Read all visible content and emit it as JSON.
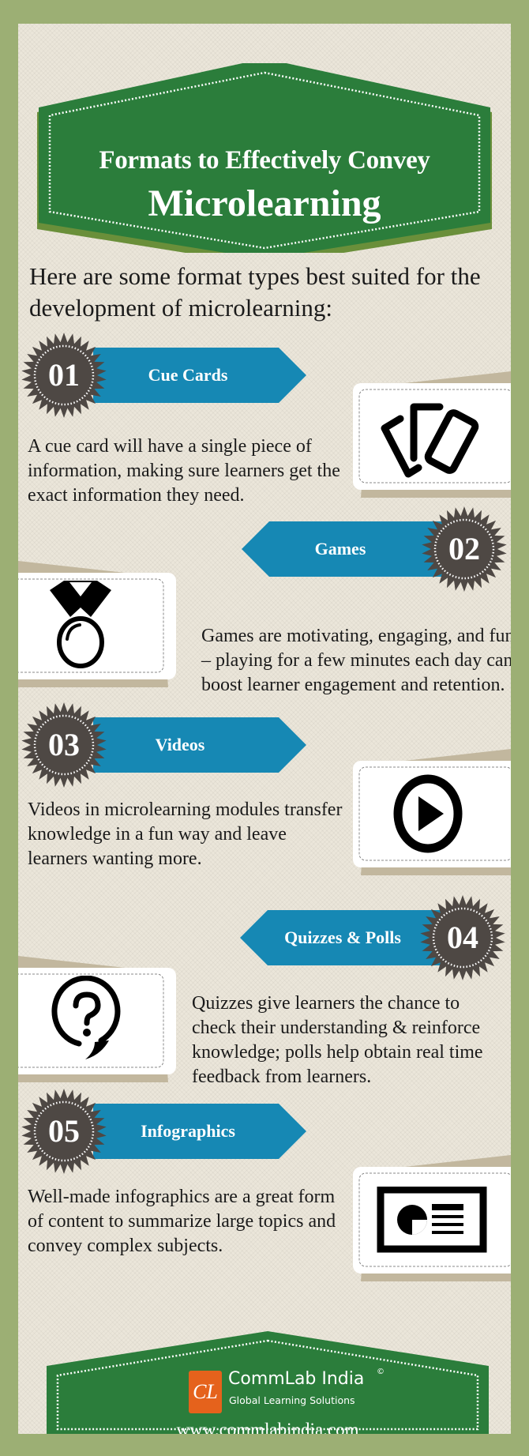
{
  "colors": {
    "frame": "#9caf74",
    "paper": "#ebe6da",
    "banner_green": "#2b7d3b",
    "ribbon_blue": "#1688b4",
    "badge_dark": "#4e4844",
    "card_shadow": "#c2b79e"
  },
  "header": {
    "title_line1": "Formats to Effectively Convey",
    "title_line2": "Microlearning"
  },
  "intro": "Here are some format types best suited for the development of microlearning:",
  "formats": [
    {
      "number": "01",
      "title": "Cue Cards",
      "description": "A cue card will have a single piece of information, making sure learners get the exact information they need.",
      "icon": "cue-cards-icon"
    },
    {
      "number": "02",
      "title": "Games",
      "description": "Games are motivating, engaging, and fun – playing for a few minutes each day can boost learner engagement and retention.",
      "icon": "medal-icon"
    },
    {
      "number": "03",
      "title": "Videos",
      "description": "Videos in microlearning modules transfer knowledge in a fun way and leave learners wanting more.",
      "icon": "play-icon"
    },
    {
      "number": "04",
      "title": "Quizzes & Polls",
      "description": "Quizzes give learners the chance to check their understanding & reinforce knowledge; polls help obtain real time feedback from learners.",
      "icon": "question-bubble-icon"
    },
    {
      "number": "05",
      "title": "Infographics",
      "description": "Well-made infographics are a great form of content to summarize large topics and convey complex subjects.",
      "icon": "infographic-icon"
    }
  ],
  "footer": {
    "logo_mark": "CL",
    "company": "CommLab India",
    "registered": "©",
    "tagline": "Global Learning Solutions",
    "website": "www.commlabindia.com"
  }
}
